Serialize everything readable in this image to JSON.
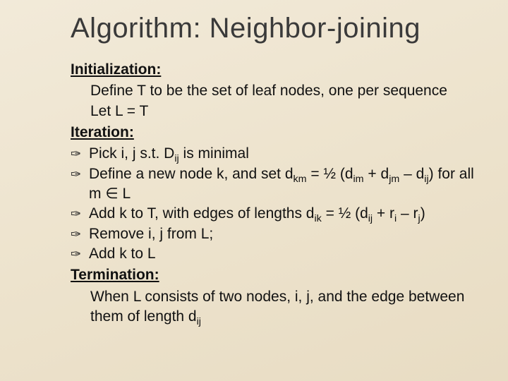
{
  "title": "Algorithm: Neighbor-joining",
  "sections": {
    "init": {
      "heading": "Initialization:",
      "line1": "Define T to be the set of leaf nodes, one per sequence",
      "line2": "Let L = T"
    },
    "iter": {
      "heading": "Iteration:",
      "b1a": "Pick i, j s.t. D",
      "b1sub": "ij",
      "b1b": " is minimal",
      "b2a": "Define a new node k, and set d",
      "b2s1": "km",
      "b2b": " = ½ (d",
      "b2s2": "im",
      "b2c": " + d",
      "b2s3": "jm",
      "b2d": " – d",
      "b2s4": "ij",
      "b2e": ") for all m ∈ L",
      "b3a": "Add k to T, with edges of lengths d",
      "b3s1": "ik",
      "b3b": " = ½ (d",
      "b3s2": "ij",
      "b3c": " + r",
      "b3s3": "i",
      "b3d": " – r",
      "b3s4": "j",
      "b3e": ")",
      "b4": "Remove i, j from L;",
      "b5": "Add k to L"
    },
    "term": {
      "heading": "Termination:",
      "l1a": "When L consists of two nodes, i, j, and the edge between them of length d",
      "l1s": "ij"
    }
  },
  "bullet_glyph": "✑"
}
